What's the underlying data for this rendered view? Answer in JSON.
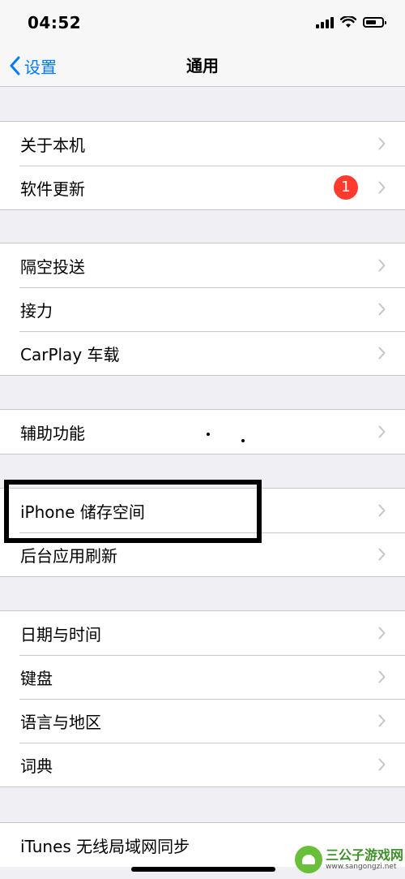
{
  "status": {
    "time": "04:52"
  },
  "nav": {
    "back_label": "设置",
    "title": "通用"
  },
  "groups": [
    {
      "rows": [
        {
          "label": "关于本机"
        },
        {
          "label": "软件更新",
          "badge": "1"
        }
      ]
    },
    {
      "rows": [
        {
          "label": "隔空投送"
        },
        {
          "label": "接力"
        },
        {
          "label": "CarPlay 车载"
        }
      ]
    },
    {
      "rows": [
        {
          "label": "辅助功能"
        }
      ]
    },
    {
      "rows": [
        {
          "label": "iPhone 储存空间"
        },
        {
          "label": "后台应用刷新"
        }
      ]
    },
    {
      "rows": [
        {
          "label": "日期与时间"
        },
        {
          "label": "键盘"
        },
        {
          "label": "语言与地区"
        },
        {
          "label": "词典"
        }
      ]
    },
    {
      "rows": [
        {
          "label": "iTunes 无线局域网同步"
        }
      ]
    }
  ],
  "watermark": {
    "title": "三公子游戏网",
    "url": "www.sangongzi.net"
  },
  "colors": {
    "accent": "#007aff",
    "badge": "#ff3b30",
    "background": "#efeff4",
    "separator": "#c8c7cc"
  },
  "icons": [
    "signal-icon",
    "wifi-icon",
    "battery-icon",
    "back-chevron-icon",
    "chevron-right-icon"
  ]
}
